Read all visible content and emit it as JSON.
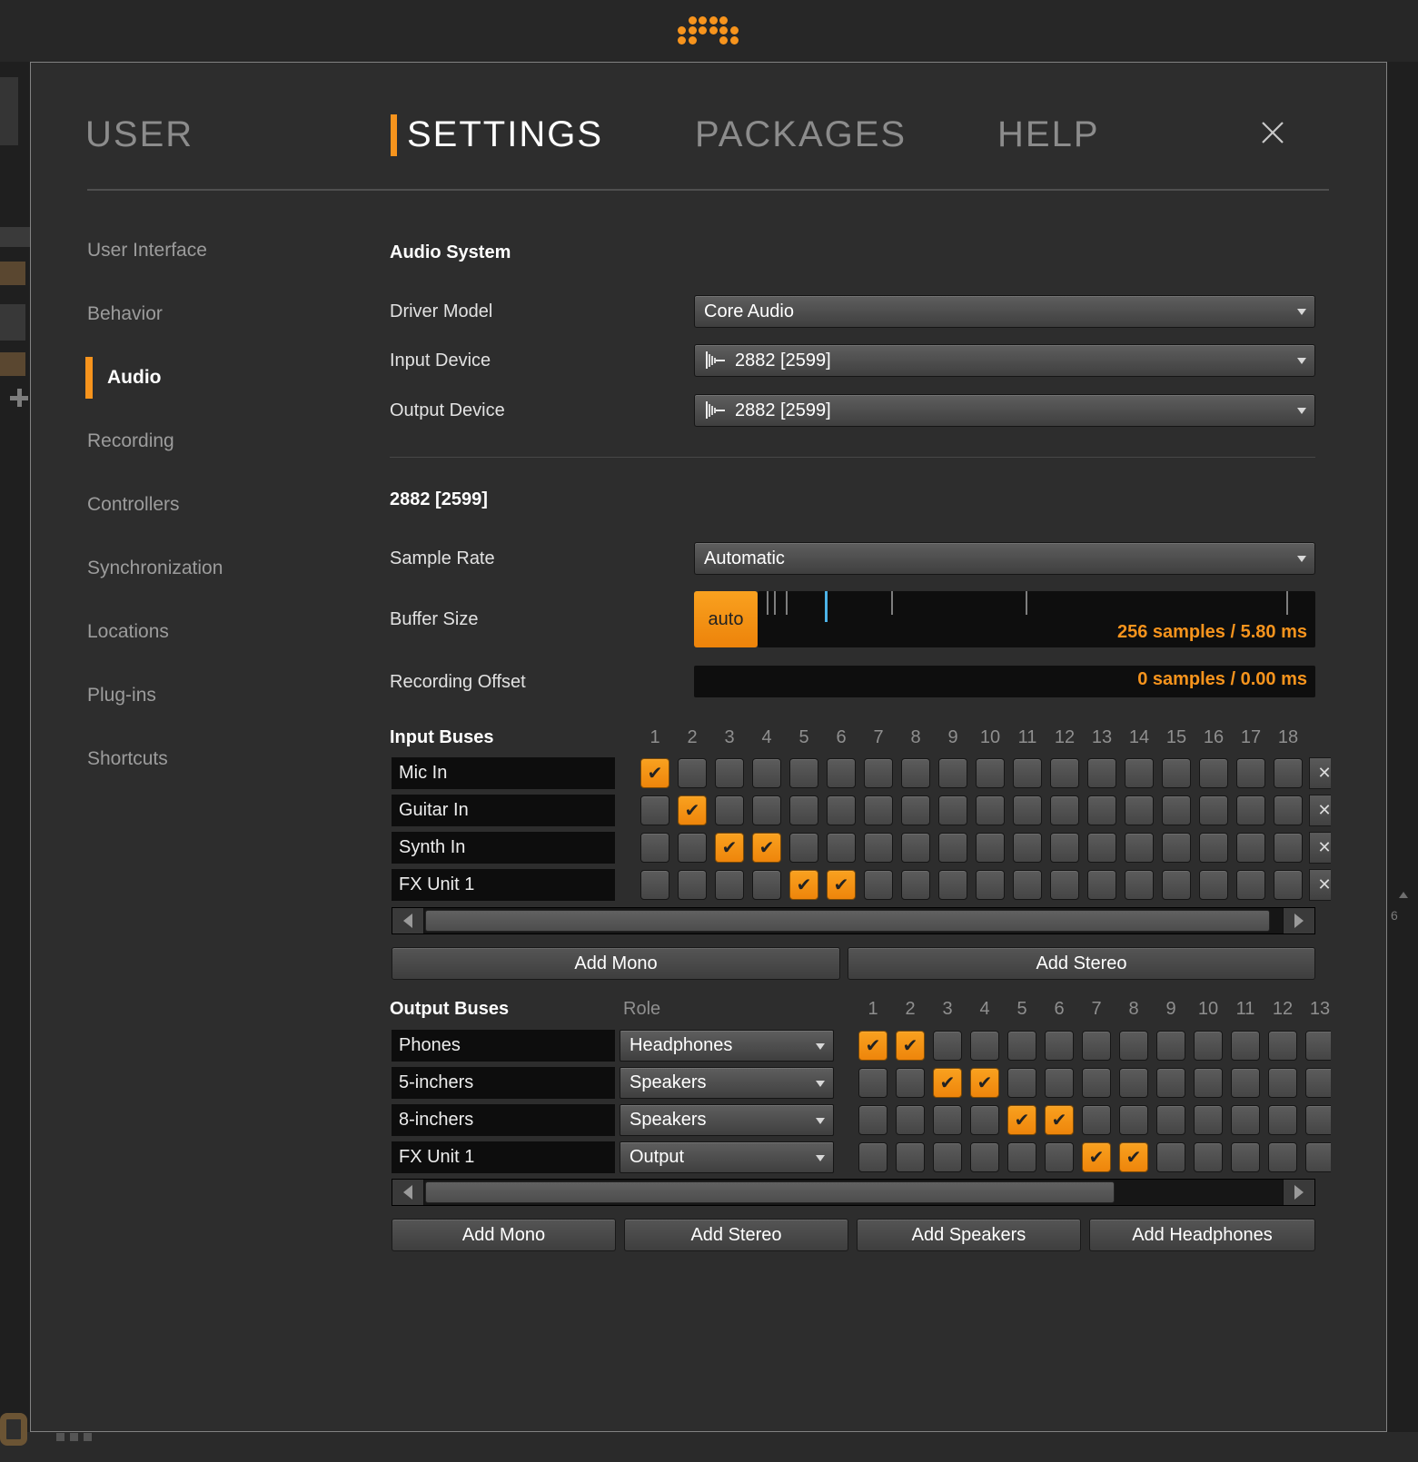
{
  "logo": {
    "rows": [
      "011110",
      "111111",
      "110011"
    ]
  },
  "header": {
    "tabs": [
      {
        "label": "USER",
        "active": false
      },
      {
        "label": "SETTINGS",
        "active": true
      },
      {
        "label": "PACKAGES",
        "active": false
      },
      {
        "label": "HELP",
        "active": false
      }
    ],
    "close_icon": "close-x"
  },
  "sidebar": {
    "items": [
      {
        "label": "User Interface",
        "active": false
      },
      {
        "label": "Behavior",
        "active": false
      },
      {
        "label": "Audio",
        "active": true
      },
      {
        "label": "Recording",
        "active": false
      },
      {
        "label": "Controllers",
        "active": false
      },
      {
        "label": "Synchronization",
        "active": false
      },
      {
        "label": "Locations",
        "active": false
      },
      {
        "label": "Plug-ins",
        "active": false
      },
      {
        "label": "Shortcuts",
        "active": false
      }
    ]
  },
  "audio_system": {
    "title": "Audio System",
    "driver_model": {
      "label": "Driver Model",
      "value": "Core Audio"
    },
    "input_device": {
      "label": "Input Device",
      "value": "2882 [2599]",
      "icon": "waveform-icon"
    },
    "output_device": {
      "label": "Output Device",
      "value": "2882 [2599]",
      "icon": "waveform-icon"
    }
  },
  "device_section": {
    "title": "2882 [2599]",
    "sample_rate": {
      "label": "Sample Rate",
      "value": "Automatic"
    },
    "buffer_size": {
      "label": "Buffer Size",
      "auto_label": "auto",
      "value": "256 samples / 5.80 ms",
      "ticks": [
        {
          "pos": 0.016
        },
        {
          "pos": 0.029
        },
        {
          "pos": 0.051
        },
        {
          "pos": 0.12,
          "current": true
        },
        {
          "pos": 0.24
        },
        {
          "pos": 0.48
        },
        {
          "pos": 0.948
        }
      ]
    },
    "recording_offset": {
      "label": "Recording Offset",
      "value": "0 samples / 0.00 ms"
    }
  },
  "input_buses": {
    "title": "Input Buses",
    "columns": [
      "1",
      "2",
      "3",
      "4",
      "5",
      "6",
      "7",
      "8",
      "9",
      "10",
      "11",
      "12",
      "13",
      "14",
      "15",
      "16",
      "17",
      "18"
    ],
    "rows": [
      {
        "name": "Mic In",
        "checked": [
          1
        ]
      },
      {
        "name": "Guitar In",
        "checked": [
          2
        ]
      },
      {
        "name": "Synth In",
        "checked": [
          3,
          4
        ]
      },
      {
        "name": "FX Unit 1",
        "checked": [
          5,
          6
        ]
      }
    ],
    "delete_icon": "✕",
    "check_icon": "✔",
    "buttons": [
      "Add Mono",
      "Add Stereo"
    ]
  },
  "output_buses": {
    "title": "Output Buses",
    "role_header": "Role",
    "columns": [
      "1",
      "2",
      "3",
      "4",
      "5",
      "6",
      "7",
      "8",
      "9",
      "10",
      "11",
      "12",
      "13"
    ],
    "rows": [
      {
        "name": "Phones",
        "role": "Headphones",
        "checked": [
          1,
          2
        ]
      },
      {
        "name": "5-inchers",
        "role": "Speakers",
        "checked": [
          3,
          4
        ]
      },
      {
        "name": "8-inchers",
        "role": "Speakers",
        "checked": [
          5,
          6
        ]
      },
      {
        "name": "FX Unit 1",
        "role": "Output",
        "checked": [
          7,
          8
        ]
      }
    ],
    "check_icon": "✔",
    "buttons": [
      "Add Mono",
      "Add Stereo",
      "Add Speakers",
      "Add Headphones"
    ]
  },
  "background": {
    "right_fragment": "6"
  },
  "colors": {
    "accent": "#f7941d",
    "buffer_current_tick": "#4cb3e8"
  }
}
